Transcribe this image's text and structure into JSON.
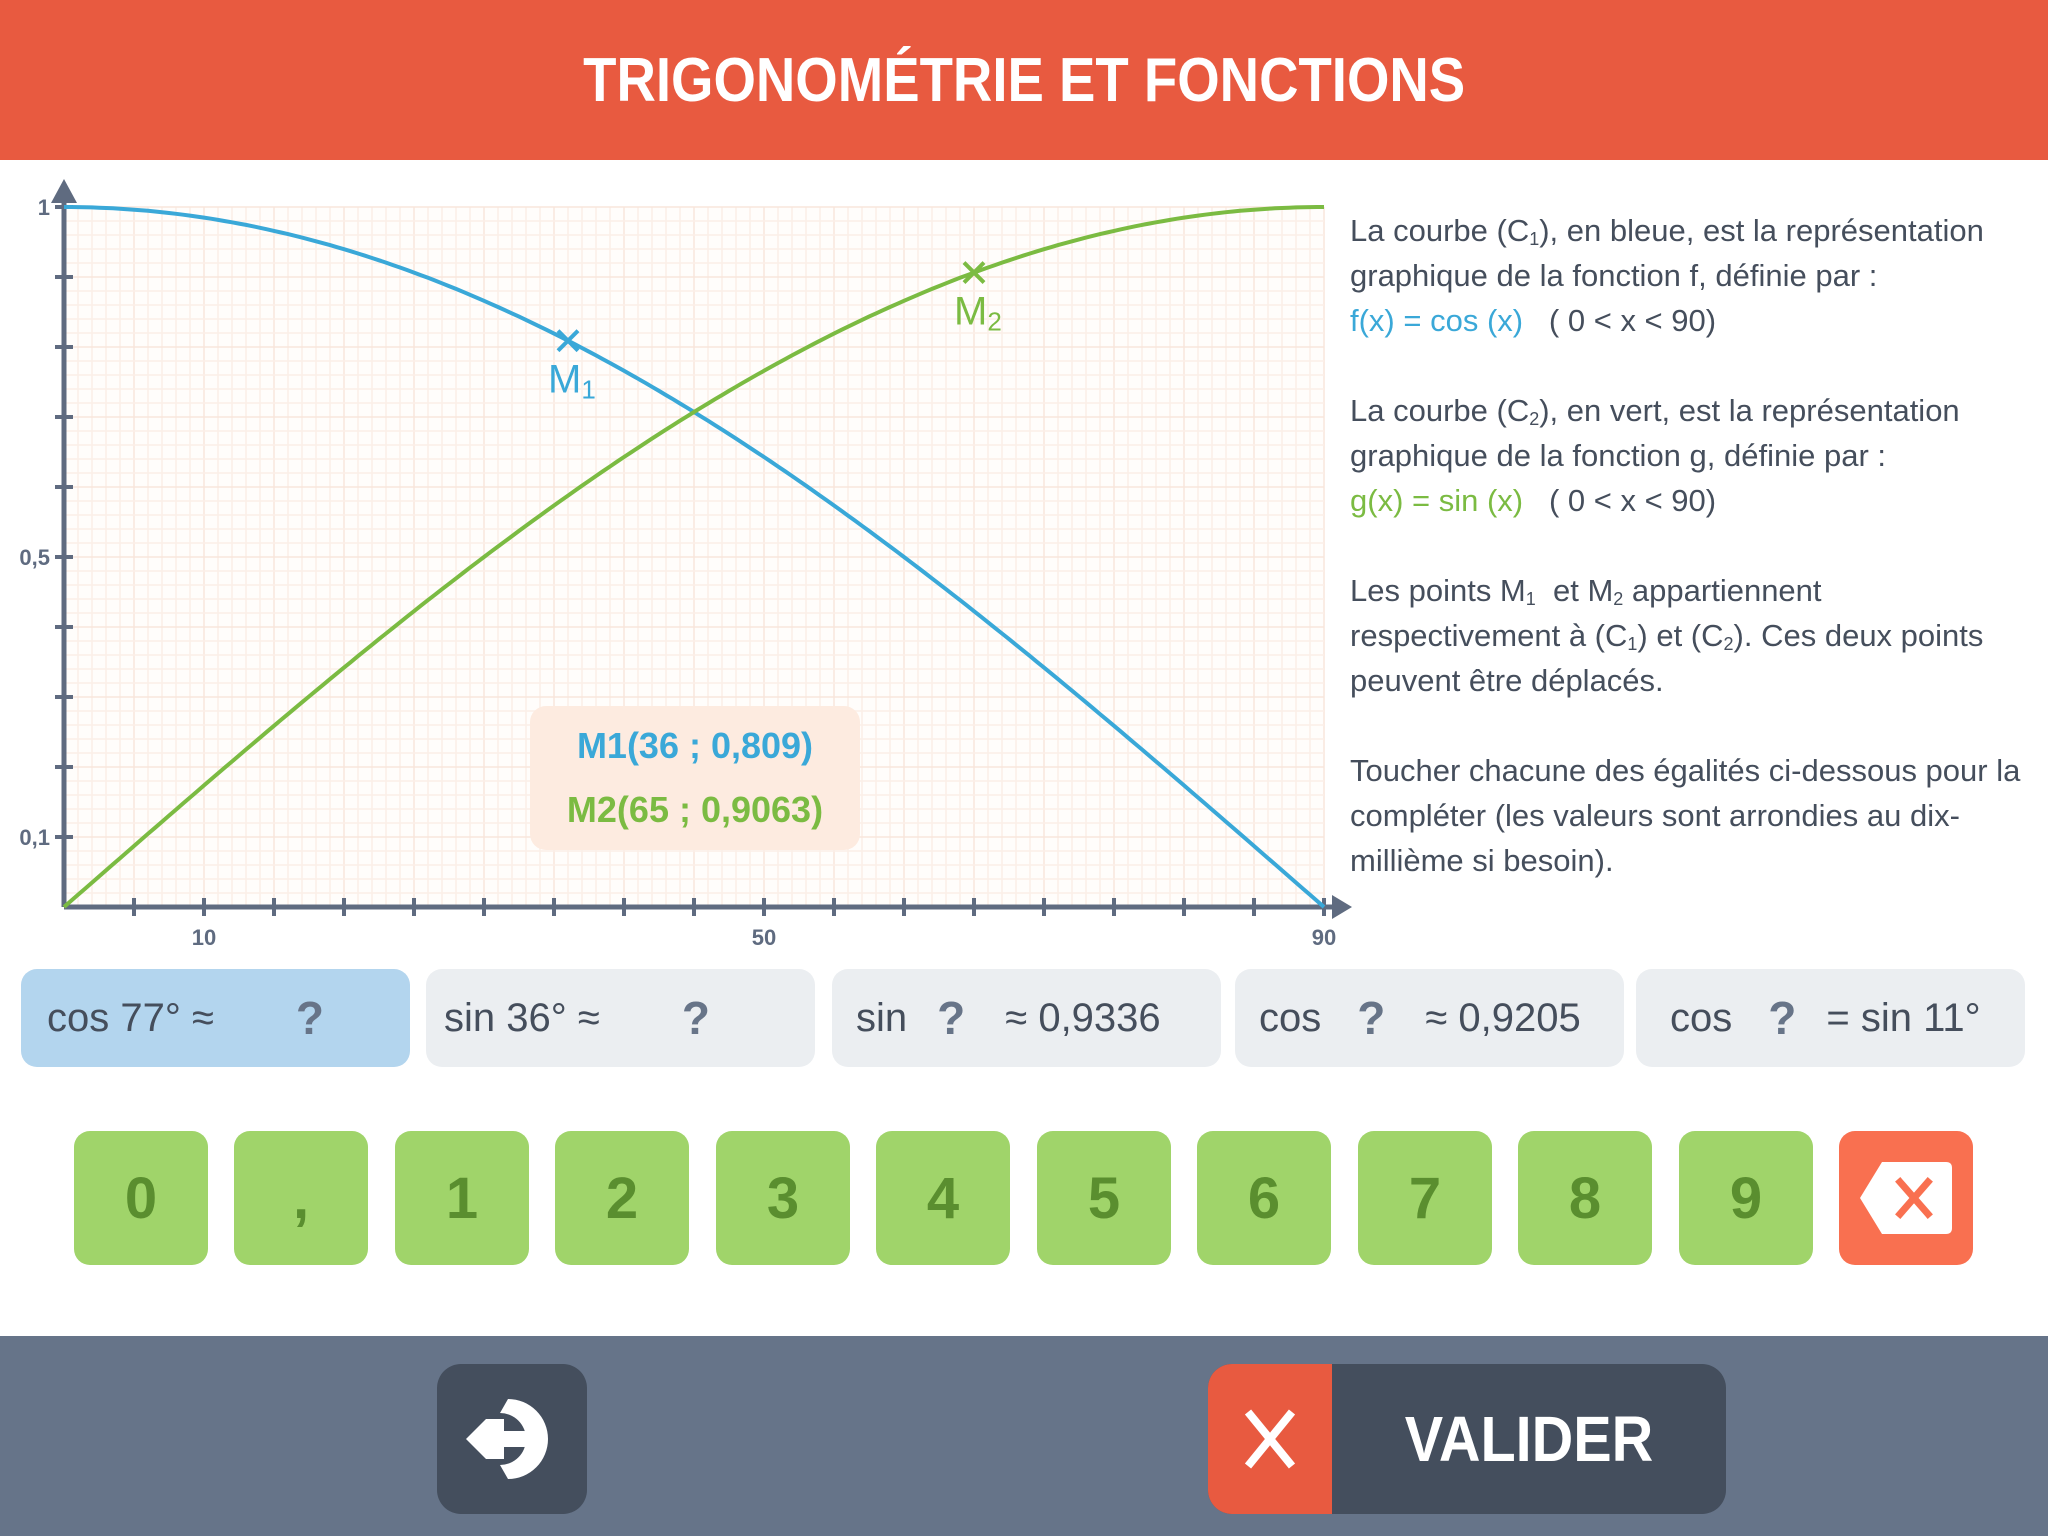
{
  "header": {
    "title": "TRIGONOMÉTRIE ET FONCTIONS"
  },
  "colors": {
    "header": "#e85a40",
    "cos_curve": "#3aa8d8",
    "sin_curve": "#7bbb42",
    "axis": "#5f6b80",
    "footer": "#667489"
  },
  "chart_data": {
    "type": "line",
    "title": "",
    "xlabel": "",
    "ylabel": "",
    "xlim": [
      0,
      90
    ],
    "ylim": [
      0,
      1
    ],
    "grid": true,
    "x_ticks": [
      5,
      10,
      15,
      20,
      25,
      30,
      35,
      40,
      45,
      50,
      55,
      60,
      65,
      70,
      75,
      80,
      85,
      90
    ],
    "x_tick_labels": [
      {
        "value": 10,
        "label": "10"
      },
      {
        "value": 50,
        "label": "50"
      },
      {
        "value": 90,
        "label": "90"
      }
    ],
    "y_ticks": [
      0.1,
      0.2,
      0.3,
      0.4,
      0.5,
      0.6,
      0.7,
      0.8,
      0.9,
      1
    ],
    "y_tick_labels": [
      {
        "value": 1,
        "label": "1"
      },
      {
        "value": 0.5,
        "label": "0,5"
      },
      {
        "value": 0.1,
        "label": "0,1"
      }
    ],
    "series": [
      {
        "name": "C1",
        "function": "cos(x)",
        "color": "#3aa8d8",
        "x": [
          0,
          5,
          10,
          15,
          20,
          25,
          30,
          35,
          40,
          45,
          50,
          55,
          60,
          65,
          70,
          75,
          80,
          85,
          90
        ],
        "y": [
          1,
          0.9962,
          0.9848,
          0.9659,
          0.9397,
          0.9063,
          0.866,
          0.8192,
          0.766,
          0.7071,
          0.6428,
          0.5736,
          0.5,
          0.4226,
          0.342,
          0.2588,
          0.1736,
          0.0872,
          0
        ]
      },
      {
        "name": "C2",
        "function": "sin(x)",
        "color": "#7bbb42",
        "x": [
          0,
          5,
          10,
          15,
          20,
          25,
          30,
          35,
          40,
          45,
          50,
          55,
          60,
          65,
          70,
          75,
          80,
          85,
          90
        ],
        "y": [
          0,
          0.0872,
          0.1736,
          0.2588,
          0.342,
          0.4226,
          0.5,
          0.5736,
          0.6428,
          0.7071,
          0.766,
          0.8192,
          0.866,
          0.9063,
          0.9397,
          0.9659,
          0.9848,
          0.9962,
          1
        ]
      }
    ],
    "points": [
      {
        "name": "M1",
        "label": "M",
        "sub": "1",
        "x": 36,
        "y": 0.809,
        "color": "#3aa8d8"
      },
      {
        "name": "M2",
        "label": "M",
        "sub": "2",
        "x": 65,
        "y": 0.9063,
        "color": "#7bbb42"
      }
    ]
  },
  "coords_box": {
    "m1": "M1(36 ; 0,809)",
    "m2": "M2(65 ; 0,9063)"
  },
  "description": {
    "p1_a": "La courbe (C",
    "p1_sub": "1",
    "p1_b": "), en bleue, est la représentation graphique de la fonction f, définie par :",
    "p1_formula": "f(x) = cos (x)",
    "p1_domain": "   ( 0 < x < 90)",
    "p2_a": "La courbe (C",
    "p2_sub": "2",
    "p2_b": "), en vert, est la représentation graphique de la fonction g, définie par :",
    "p2_formula": "g(x) = sin (x)",
    "p2_domain": "   ( 0 < x < 90)",
    "p3_a": "Les points M",
    "p3_sub1": "1",
    "p3_b": "  et M",
    "p3_sub2": "2",
    "p3_c": " appartiennent respectivement à (C",
    "p3_sub3": "1",
    "p3_d": ") et (C",
    "p3_sub4": "2",
    "p3_e": "). Ces deux points peuvent être déplacés.",
    "p4": "Toucher chacune des égalités ci-dessous pour la compléter (les valeurs sont arrondies au dix-millième si besoin)."
  },
  "equations": [
    {
      "parts": [
        "cos 77° ≈",
        "?",
        ""
      ],
      "active": true
    },
    {
      "parts": [
        "sin 36° ≈",
        "?",
        ""
      ],
      "active": false
    },
    {
      "parts": [
        "sin",
        "?",
        "≈ 0,9336"
      ],
      "active": false
    },
    {
      "parts": [
        "cos",
        "?",
        "≈ 0,9205"
      ],
      "active": false
    },
    {
      "parts": [
        "cos",
        "?",
        "= sin 11°"
      ],
      "active": false
    }
  ],
  "keypad": {
    "keys": [
      "0",
      ",",
      "1",
      "2",
      "3",
      "4",
      "5",
      "6",
      "7",
      "8",
      "9"
    ],
    "delete_icon": "backspace-icon"
  },
  "footer": {
    "back_icon": "exit-icon",
    "validate_label": "VALIDER",
    "validate_icon": "close-icon"
  }
}
